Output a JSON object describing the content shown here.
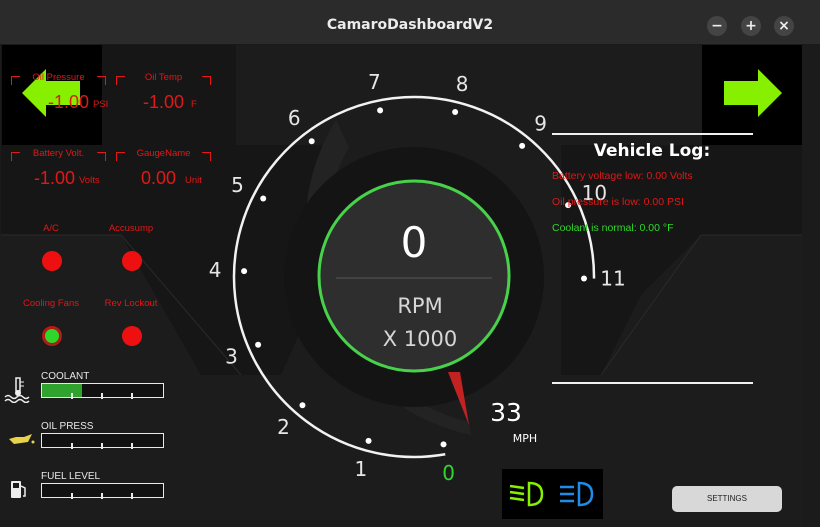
{
  "window": {
    "title": "CamaroDashboardV2",
    "buttons": {
      "minimize": "−",
      "maximize": "+",
      "close": "×"
    }
  },
  "gauges": [
    {
      "name": "Oil Pressure",
      "value": "-1.00",
      "unit": "PSI"
    },
    {
      "name": "Oil Temp",
      "value": "-1.00",
      "unit": "F"
    },
    {
      "name": "Battery Volt.",
      "value": "-1.00",
      "unit": "Volts"
    },
    {
      "name": "GaugeName",
      "value": "0.00",
      "unit": "Unit"
    }
  ],
  "indicators": [
    {
      "label": "A/C",
      "state": "red"
    },
    {
      "label": "Accusump",
      "state": "red"
    },
    {
      "label": "Cooling Fans",
      "state": "green"
    },
    {
      "label": "Rev Lockout",
      "state": "red"
    }
  ],
  "bars": [
    {
      "label": "COOLANT",
      "icon": "coolant-temp-icon",
      "level": 0.33
    },
    {
      "label": "OIL PRESS",
      "icon": "oil-can-icon",
      "level": 0
    },
    {
      "label": "FUEL LEVEL",
      "icon": "fuel-pump-icon",
      "level": 0
    }
  ],
  "tach": {
    "rpm_value": "0",
    "rpm_label": "RPM",
    "multiplier_label": "X 1000",
    "ticks": [
      "0",
      "1",
      "2",
      "3",
      "4",
      "5",
      "6",
      "7",
      "8",
      "9",
      "10",
      "11"
    ],
    "needle_rpm": 0
  },
  "speed": {
    "value": "33",
    "unit": "MPH"
  },
  "log": {
    "title": "Vehicle Log:",
    "entries": [
      {
        "text": "Battery voltage low: 0.00 Volts",
        "color": "#e01818"
      },
      {
        "text": "Oil pressure is low: 0.00 PSI",
        "color": "#e01818"
      },
      {
        "text": "Coolant is normal: 0.00 °F",
        "color": "#2ed82a"
      }
    ]
  },
  "settings_label": "SETTINGS",
  "colors": {
    "arrow": "#86f000",
    "alert": "#e01818",
    "ok": "#2ed82a",
    "ring": "#47d24a",
    "low_beam": "#86f000",
    "high_beam": "#1e8ce8"
  }
}
